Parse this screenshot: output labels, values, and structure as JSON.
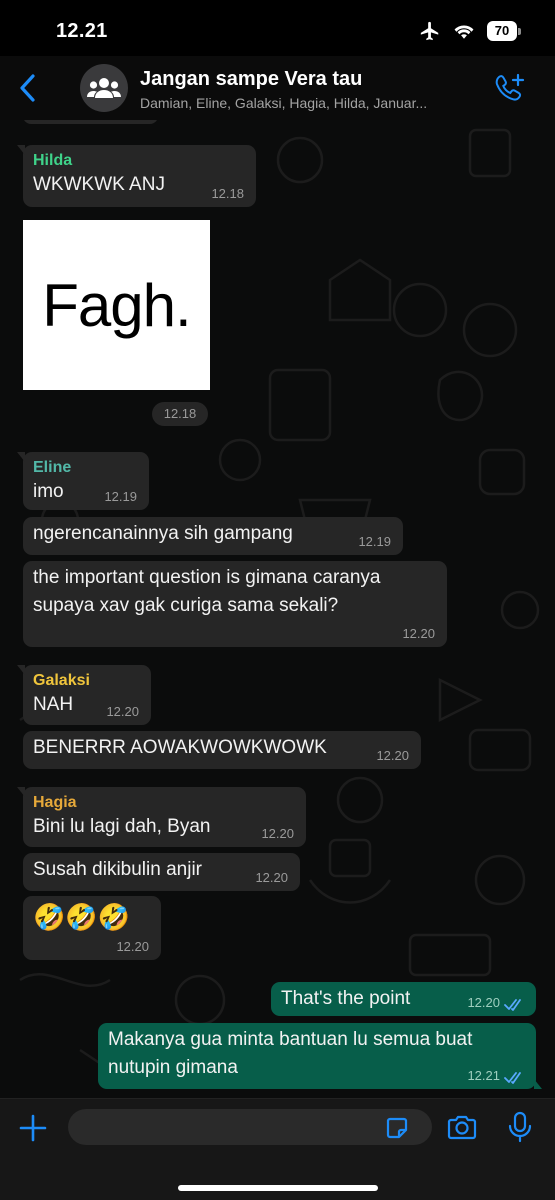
{
  "status": {
    "time": "12.21",
    "battery": "70"
  },
  "header": {
    "title": "Jangan sampe Vera tau",
    "members": "Damian, Eline, Galaksi, Hagia, Hilda, Januar..."
  },
  "colors": {
    "accent_blue": "#1d8cf8",
    "outgoing_bubble": "#075e4a",
    "incoming_bubble": "#262626",
    "sender_hilda": "#3fd38a",
    "sender_eline": "#52b8a8",
    "sender_galaksi": "#f0c53c",
    "sender_hagia": "#e6a93a"
  },
  "messages": [
    {
      "sender": "Hilda",
      "text": "WKWKWK ANJ",
      "time": "12.18"
    },
    {
      "image_text": "Fagh.",
      "time": "12.18"
    },
    {
      "sender": "Eline",
      "text": "imo",
      "time": "12.19"
    },
    {
      "text": "ngerencanainnya sih gampang",
      "time": "12.19"
    },
    {
      "text": "the important question is gimana caranya supaya xav gak curiga sama sekali?",
      "time": "12.20"
    },
    {
      "sender": "Galaksi",
      "text": "NAH",
      "time": "12.20"
    },
    {
      "text": "BENERRR AOWAKWOWKWOWK",
      "time": "12.20"
    },
    {
      "sender": "Hagia",
      "text": "Bini lu lagi dah, Byan",
      "time": "12.20"
    },
    {
      "text": "Susah dikibulin anjir",
      "time": "12.20"
    },
    {
      "text": "🤣🤣🤣",
      "time": "12.20"
    },
    {
      "text": "That's the point",
      "time": "12.20"
    },
    {
      "text": "Makanya gua minta bantuan lu semua buat nutupin gimana",
      "time": "12.21"
    }
  ],
  "input": {
    "placeholder": ""
  },
  "icons": [
    "back-chevron-icon",
    "group-avatar-icon",
    "add-call-icon",
    "airplane-icon",
    "wifi-icon",
    "battery-icon",
    "plus-icon",
    "sticker-icon",
    "camera-icon",
    "mic-icon",
    "double-check-icon"
  ]
}
